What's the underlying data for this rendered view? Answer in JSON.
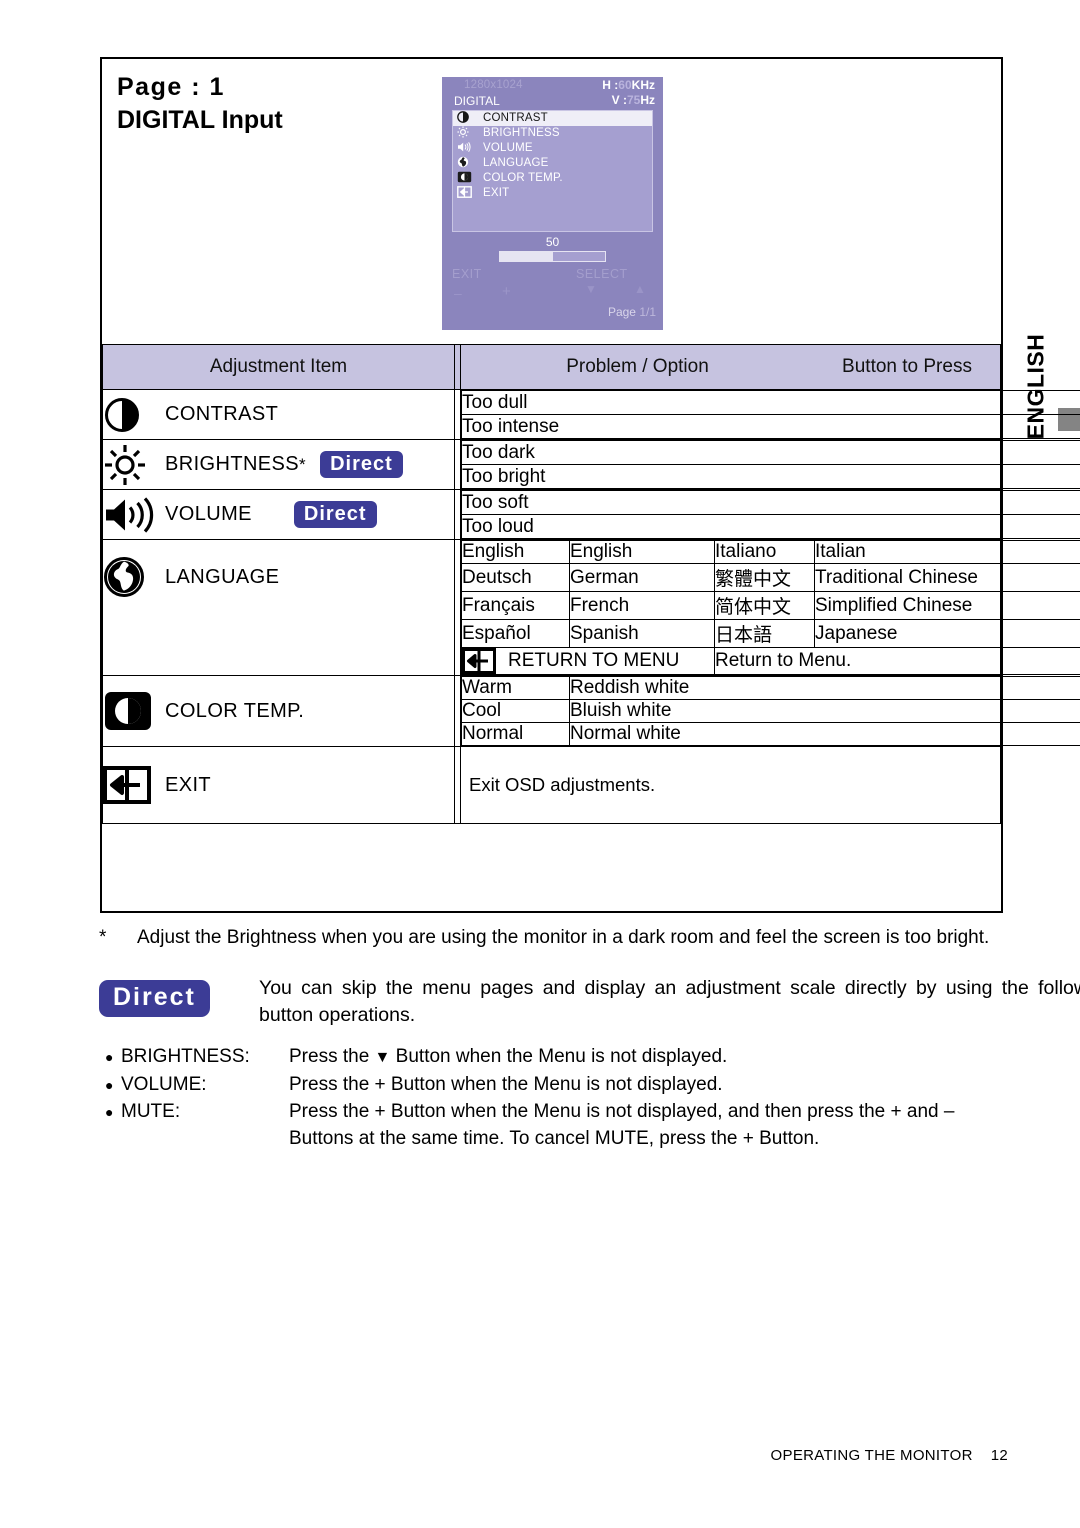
{
  "side_tab": {
    "label": "ENGLISH"
  },
  "heading": {
    "line1": "Page : 1",
    "line2": "DIGITAL Input"
  },
  "osd": {
    "resolution": "1280x1024",
    "source": "DIGITAL",
    "h_label": "H :",
    "h_value": "60",
    "h_unit": "KHz",
    "v_label": "V :",
    "v_value": "75",
    "v_unit": "Hz",
    "items": [
      {
        "icon": "contrast-icon",
        "label": "CONTRAST",
        "selected": true
      },
      {
        "icon": "brightness-icon",
        "label": "BRIGHTNESS",
        "selected": false
      },
      {
        "icon": "volume-icon",
        "label": "VOLUME",
        "selected": false
      },
      {
        "icon": "globe-icon",
        "label": "LANGUAGE",
        "selected": false
      },
      {
        "icon": "color-temp-icon",
        "label": "COLOR TEMP.",
        "selected": false
      },
      {
        "icon": "exit-icon",
        "label": "EXIT",
        "selected": false
      }
    ],
    "value": "50",
    "bar_percent": 50,
    "exit_label": "EXIT",
    "select_label": "SELECT",
    "minus_label": "–",
    "plus_label": "+",
    "down_label": "▼",
    "up_label": "▲",
    "page_label": "Page",
    "page_value": "1/1"
  },
  "table": {
    "headers": {
      "col1": "Adjustment Item",
      "col2": "Problem / Option",
      "col3": "Button to Press"
    },
    "rows": {
      "contrast": {
        "label": "CONTRAST",
        "icon": "contrast-icon",
        "options": [
          {
            "text": "Too dull",
            "key": "+"
          },
          {
            "text": "Too intense",
            "key": "–"
          }
        ]
      },
      "brightness": {
        "label": "BRIGHTNESS",
        "star": "*",
        "direct": "Direct",
        "icon": "brightness-icon",
        "options": [
          {
            "text": "Too dark",
            "key": "+"
          },
          {
            "text": "Too bright",
            "key": "–"
          }
        ]
      },
      "volume": {
        "label": "VOLUME",
        "direct": "Direct",
        "icon": "volume-icon",
        "options": [
          {
            "text": "Too soft",
            "key": "+"
          },
          {
            "text": "Too loud",
            "key": "–"
          }
        ]
      },
      "language": {
        "label": "LANGUAGE",
        "icon": "globe-icon",
        "pairs": [
          {
            "a_native": "English",
            "a_desc": "English",
            "b_native": "Italiano",
            "b_desc": "Italian"
          },
          {
            "a_native": "Deutsch",
            "a_desc": "German",
            "b_native": "繁體中文",
            "b_desc": "Traditional Chinese"
          },
          {
            "a_native": "Français",
            "a_desc": "French",
            "b_native": "简体中文",
            "b_desc": "Simplified Chinese"
          },
          {
            "a_native": "Español",
            "a_desc": "Spanish",
            "b_native": "日本語",
            "b_desc": "Japanese"
          }
        ],
        "return_label": "RETURN TO MENU",
        "return_desc": "Return to Menu.",
        "return_icon": "exit-icon"
      },
      "color_temp": {
        "label": "COLOR TEMP.",
        "icon": "color-temp-icon",
        "options": [
          {
            "name": "Warm",
            "desc": "Reddish white"
          },
          {
            "name": "Cool",
            "desc": "Bluish white"
          },
          {
            "name": "Normal",
            "desc": "Normal white"
          }
        ]
      },
      "exit": {
        "label": "EXIT",
        "icon": "exit-icon",
        "desc": "Exit OSD adjustments."
      }
    }
  },
  "footnote": {
    "mark": "*",
    "text": "Adjust the Brightness when you are using the monitor in a dark room and feel the screen is too bright."
  },
  "direct_section": {
    "badge": "Direct",
    "text": "You can skip the menu pages and display an adjustment scale directly by using the following button operations."
  },
  "bullets": [
    {
      "dot": "●",
      "name": "BRIGHTNESS:",
      "desc_pre": "Press the ",
      "desc_glyph": "▼",
      "desc_post": " Button when the Menu is not displayed.",
      "desc2": ""
    },
    {
      "dot": "●",
      "name": "VOLUME:",
      "desc_pre": "Press the + Button when the Menu is not displayed.",
      "desc_glyph": "",
      "desc_post": "",
      "desc2": ""
    },
    {
      "dot": "●",
      "name": "MUTE:",
      "desc_pre": "Press the + Button when the Menu is not displayed, and then press the + and –",
      "desc_glyph": "",
      "desc_post": "",
      "desc2": "Buttons at the same time. To cancel MUTE, press the + Button."
    }
  ],
  "footer": {
    "title": "OPERATING THE MONITOR",
    "page": "12"
  },
  "colors": {
    "header_bg": "#c6c3e0",
    "direct_badge": "#3c3c96",
    "osd_bg": "#8b85bd",
    "osd_list_bg": "#a59fd0",
    "osd_selected": "#efeef7",
    "side_bar": "#848484"
  }
}
